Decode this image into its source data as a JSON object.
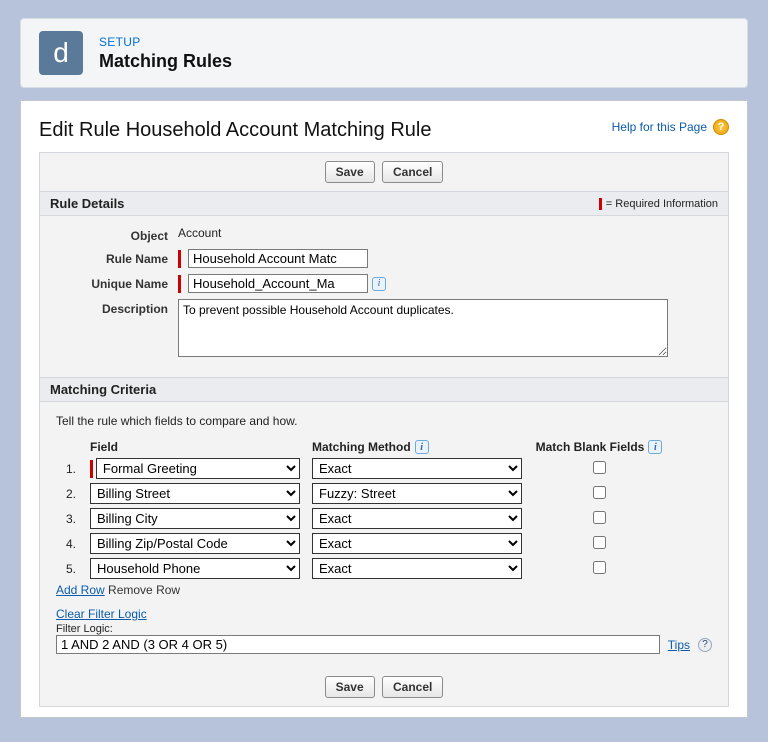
{
  "header": {
    "icon_letter": "d",
    "setup_label": "SETUP",
    "title": "Matching Rules"
  },
  "page": {
    "title": "Edit Rule Household Account Matching Rule",
    "help_text": "Help for this Page"
  },
  "buttons": {
    "save": "Save",
    "cancel": "Cancel"
  },
  "sections": {
    "details": "Rule Details",
    "criteria": "Matching Criteria",
    "required_legend": "= Required Information"
  },
  "details": {
    "labels": {
      "object": "Object",
      "rule_name": "Rule Name",
      "unique_name": "Unique Name",
      "description": "Description"
    },
    "object_value": "Account",
    "rule_name_value": "Household Account Matc",
    "unique_name_value": "Household_Account_Ma",
    "description_value": "To prevent possible Household Account duplicates."
  },
  "criteria": {
    "hint": "Tell the rule which fields to compare and how.",
    "columns": {
      "field": "Field",
      "method": "Matching Method",
      "blank": "Match Blank Fields"
    },
    "rows": [
      {
        "n": "1.",
        "field": "Formal Greeting",
        "method": "Exact",
        "blank": false,
        "required": true
      },
      {
        "n": "2.",
        "field": "Billing Street",
        "method": "Fuzzy: Street",
        "blank": false,
        "required": false
      },
      {
        "n": "3.",
        "field": "Billing City",
        "method": "Exact",
        "blank": false,
        "required": false
      },
      {
        "n": "4.",
        "field": "Billing Zip/Postal Code",
        "method": "Exact",
        "blank": false,
        "required": false
      },
      {
        "n": "5.",
        "field": "Household Phone",
        "method": "Exact",
        "blank": false,
        "required": false
      }
    ],
    "actions": {
      "add_row": "Add Row",
      "remove_row": "Remove Row",
      "clear_logic": "Clear Filter Logic",
      "filter_label": "Filter Logic:",
      "tips": "Tips"
    },
    "filter_logic": "1 AND 2 AND (3 OR 4 OR 5)"
  }
}
